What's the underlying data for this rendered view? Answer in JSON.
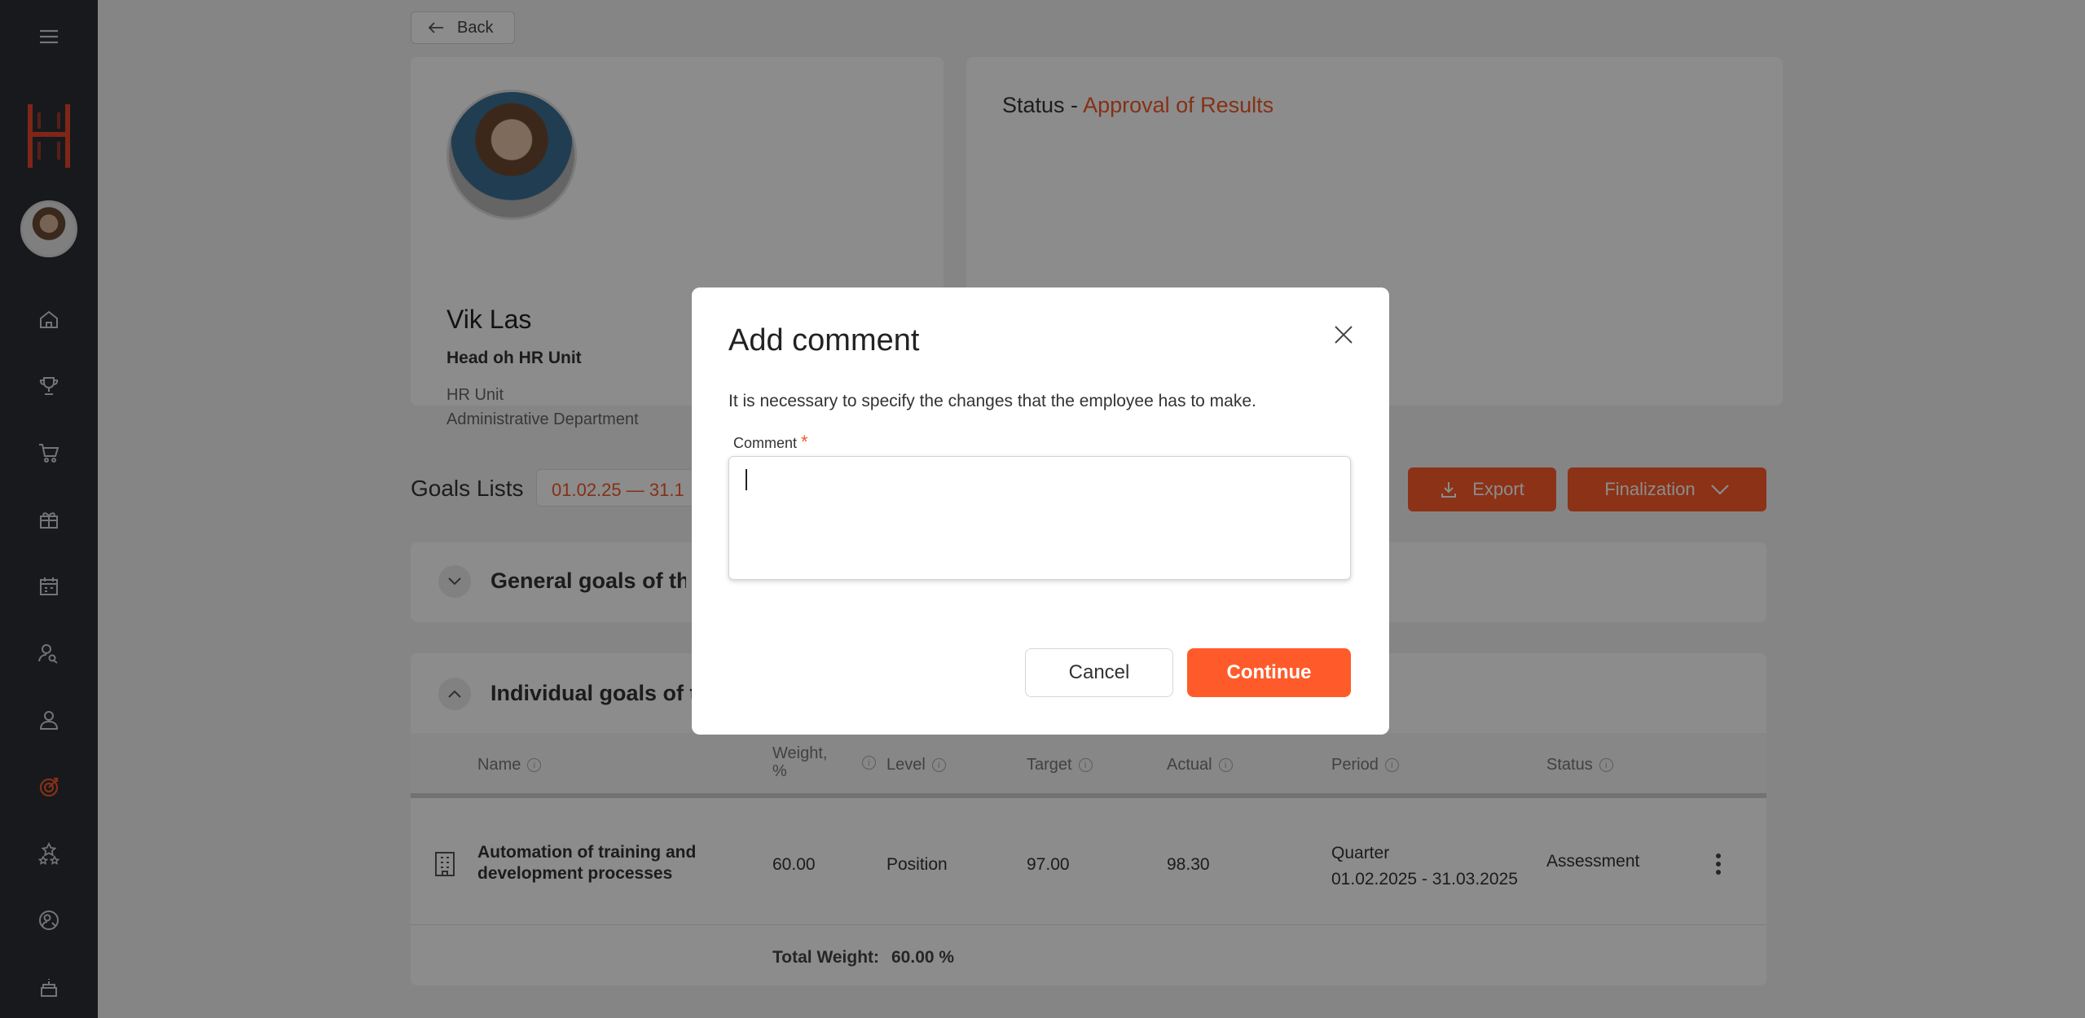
{
  "sidebar": {
    "items": [
      {
        "icon": "menu-icon"
      },
      {
        "icon": "home-icon"
      },
      {
        "icon": "trophy-icon"
      },
      {
        "icon": "cart-icon"
      },
      {
        "icon": "gift-icon"
      },
      {
        "icon": "calendar-icon"
      },
      {
        "icon": "user-search-icon"
      },
      {
        "icon": "user-icon"
      },
      {
        "icon": "target-icon",
        "active": true
      },
      {
        "icon": "stars-icon"
      },
      {
        "icon": "user-settings-icon"
      },
      {
        "icon": "cake-icon"
      }
    ],
    "accent_color": "#f05a28",
    "bg_color": "#2b2f36"
  },
  "back": {
    "label": "Back"
  },
  "profile": {
    "name": "Vik Las",
    "position": "Head oh HR Unit",
    "unit": "HR Unit",
    "department": "Administrative Department"
  },
  "status": {
    "prefix": "Status - ",
    "value": "Approval of Results"
  },
  "goals": {
    "title": "Goals Lists",
    "period": "01.02.25 — 31.1",
    "export_label": "Export",
    "finalization_label": "Finalization"
  },
  "sections": {
    "general": {
      "title": "General goals of the"
    },
    "individual": {
      "title": "Individual goals of th"
    }
  },
  "table": {
    "headers": {
      "name": "Name",
      "weight_line1": "Weight,",
      "weight_line2": "%",
      "level": "Level",
      "target": "Target",
      "actual": "Actual",
      "period": "Period",
      "status": "Status"
    },
    "rows": [
      {
        "name_line1": "Automation of training and",
        "name_line2": "development processes",
        "weight": "60.00",
        "level": "Position",
        "target": "97.00",
        "actual": "98.30",
        "period_type": "Quarter",
        "period_range": "01.02.2025 - 31.03.2025",
        "status": "Assessment"
      }
    ],
    "total_label": "Total Weight:",
    "total_value": "60.00 %"
  },
  "modal": {
    "title": "Add comment",
    "description": "It is necessary to specify the changes that the employee has to make.",
    "field_label": "Comment",
    "required_mark": "*",
    "comment_value": "",
    "cancel_label": "Cancel",
    "continue_label": "Continue",
    "primary_color": "#ff5b2a"
  }
}
